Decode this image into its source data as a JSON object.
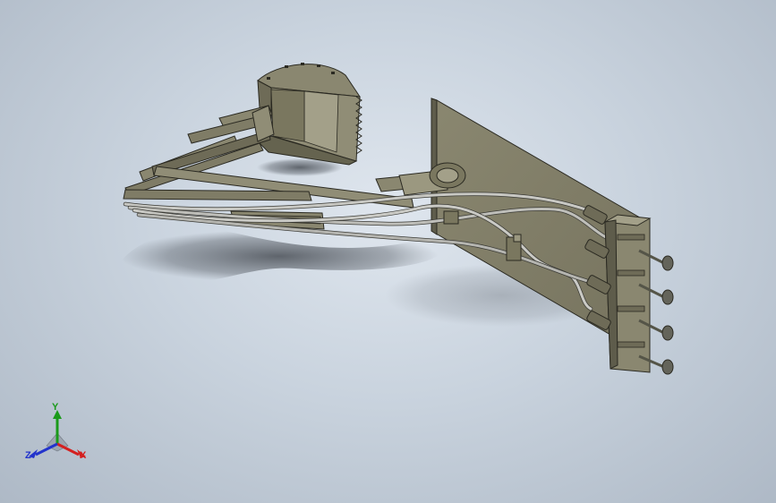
{
  "viewport": {
    "background_top": "#dfe6ee",
    "background_bottom": "#aeb9c6"
  },
  "model": {
    "body_color": "#7f7c66",
    "body_shade": "#5e5c4b",
    "body_light": "#9b9880",
    "hose_color": "#b7b7b2",
    "plunger_color": "#6a6a5a"
  },
  "triad": {
    "x_label": "X",
    "y_label": "Y",
    "z_label": "Z",
    "x_color": "#d42020",
    "y_color": "#1a9a1a",
    "z_color": "#2233cc"
  }
}
